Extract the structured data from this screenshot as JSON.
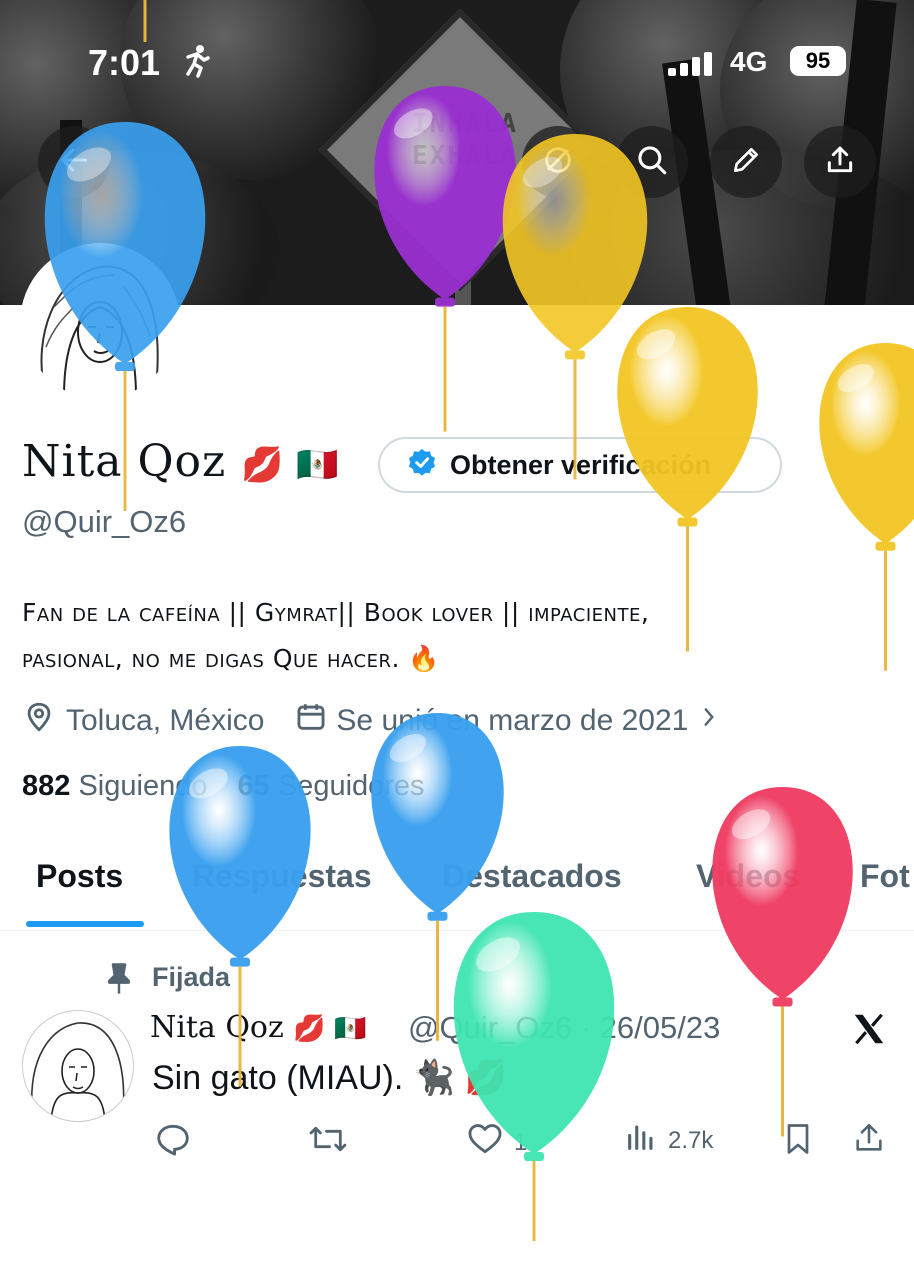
{
  "status_bar": {
    "time": "7:01",
    "network": "4G",
    "battery": "95"
  },
  "banner": {
    "sign_line1": "INHALA",
    "sign_line2": "EXHALA"
  },
  "profile": {
    "display_name": "Nita Qoz",
    "name_emojis": "💋 🇲🇽",
    "verify_label": "Obtener verificación",
    "handle": "@Quir_Oz6",
    "bio_line1": "Fan de la cafeína || Gymrat|| Book lover || impaciente,",
    "bio_line2": "pasional, no me digas Que hacer. 🔥",
    "location": "Toluca, México",
    "joined": "Se unió en marzo de 2021",
    "following_count": "882",
    "following_label": "Siguiendo",
    "followers_count": "65",
    "followers_label": "Seguidores"
  },
  "tabs": [
    {
      "label": "Posts"
    },
    {
      "label": "Respuestas"
    },
    {
      "label": "Destacados"
    },
    {
      "label": "Videos"
    },
    {
      "label": "Fot"
    }
  ],
  "post": {
    "pinned_label": "Fijada",
    "author_name": "Nita Qoz",
    "author_emojis": "💋 🇲🇽",
    "meta": "@Quir_Oz6 · 26/05/23",
    "text": "Sin gato (MIAU). 🐈‍⬛ 💋",
    "likes": "1",
    "views": "2.7k"
  },
  "colors": {
    "accent": "#1d9bf0",
    "secondary_text": "#536471",
    "balloon_blue": "#3aa0ef",
    "balloon_purple": "#9a2fd1",
    "balloon_yellow": "#f3c623",
    "balloon_red": "#ef3d63",
    "balloon_green": "#3ee5b0"
  },
  "icons": [
    "running-icon",
    "back-arrow-icon",
    "grok-icon",
    "search-icon",
    "edit-pencil-icon",
    "share-icon",
    "verified-badge-icon",
    "location-pin-icon",
    "calendar-icon",
    "chevron-right-icon",
    "pin-icon",
    "x-logo-icon",
    "reply-icon",
    "repost-icon",
    "like-icon",
    "views-icon",
    "bookmark-icon",
    "share-icon"
  ]
}
